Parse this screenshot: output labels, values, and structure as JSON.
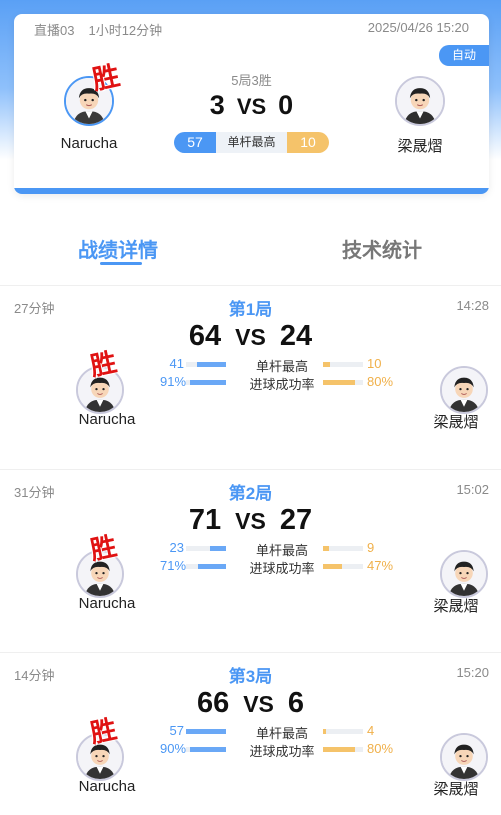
{
  "header": {
    "channel": "直播03",
    "duration": "1小时12分钟",
    "datetime": "2025/04/26 15:20",
    "auto_label": "自动",
    "rule": "5局3胜",
    "score_left": "3",
    "vs": "VS",
    "score_right": "0",
    "best_left": "57",
    "best_label": "单杆最高",
    "best_right": "10",
    "win_label": "胜"
  },
  "players": {
    "left": "Narucha",
    "right": "梁晟熠"
  },
  "tabs": {
    "active": "战绩详情",
    "inactive": "技术统计"
  },
  "stat_labels": {
    "best": "单杆最高",
    "rate": "进球成功率"
  },
  "frames": [
    {
      "duration": "27分钟",
      "title": "第1局",
      "time": "14:28",
      "score_left": "64",
      "score_right": "24",
      "best_left": "41",
      "best_right": "10",
      "rate_left": "91%",
      "rate_right": "80%"
    },
    {
      "duration": "31分钟",
      "title": "第2局",
      "time": "15:02",
      "score_left": "71",
      "score_right": "27",
      "best_left": "23",
      "best_right": "9",
      "rate_left": "71%",
      "rate_right": "47%"
    },
    {
      "duration": "14分钟",
      "title": "第3局",
      "time": "15:20",
      "score_left": "66",
      "score_right": "6",
      "best_left": "57",
      "best_right": "4",
      "rate_left": "90%",
      "rate_right": "80%"
    }
  ],
  "colors": {
    "accent": "#4b97f4",
    "opponent": "#f5c36a",
    "win": "#e01212"
  }
}
